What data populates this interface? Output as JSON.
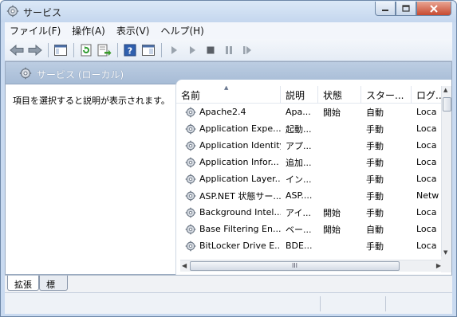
{
  "window": {
    "title": "サービス"
  },
  "menu": [
    "ファイル(F)",
    "操作(A)",
    "表示(V)",
    "ヘルプ(H)"
  ],
  "scope": {
    "title": "サービス (ローカル)"
  },
  "description": {
    "text": "項目を選択すると説明が表示されます。"
  },
  "columns": [
    "名前",
    "説明",
    "状態",
    "スター...",
    "ログ..."
  ],
  "services": [
    {
      "name": "Apache2.4",
      "desc": "Apa...",
      "status": "開始",
      "startup": "自動",
      "logon": "Loca"
    },
    {
      "name": "Application Expe...",
      "desc": "起動...",
      "status": "",
      "startup": "手動",
      "logon": "Loca"
    },
    {
      "name": "Application Identity",
      "desc": "アプ...",
      "status": "",
      "startup": "手動",
      "logon": "Loca"
    },
    {
      "name": "Application Infor...",
      "desc": "追加...",
      "status": "",
      "startup": "手動",
      "logon": "Loca"
    },
    {
      "name": "Application Layer...",
      "desc": "イン...",
      "status": "",
      "startup": "手動",
      "logon": "Loca"
    },
    {
      "name": "ASP.NET 状態サー...",
      "desc": "ASP....",
      "status": "",
      "startup": "手動",
      "logon": "Netw"
    },
    {
      "name": "Background Intel...",
      "desc": "アイ...",
      "status": "開始",
      "startup": "手動",
      "logon": "Loca"
    },
    {
      "name": "Base Filtering En...",
      "desc": "ベー...",
      "status": "開始",
      "startup": "自動",
      "logon": "Loca"
    },
    {
      "name": "BitLocker Drive E...",
      "desc": "BDE...",
      "status": "",
      "startup": "手動",
      "logon": "Loca"
    }
  ],
  "tabs": [
    "拡張",
    "標準"
  ],
  "scrollbar": {
    "thumb_grip": "III"
  },
  "toolbar_icons": [
    "back-arrow-icon",
    "forward-arrow-icon",
    "show-hide-console-tree-icon",
    "refresh-icon",
    "export-list-icon",
    "help-icon",
    "properties-pane-icon",
    "start-service-icon",
    "start-service-alt-icon",
    "stop-service-icon",
    "pause-service-icon",
    "restart-service-icon"
  ],
  "colors": {
    "accent": "#a7bcd6",
    "close": "#c74a30"
  }
}
